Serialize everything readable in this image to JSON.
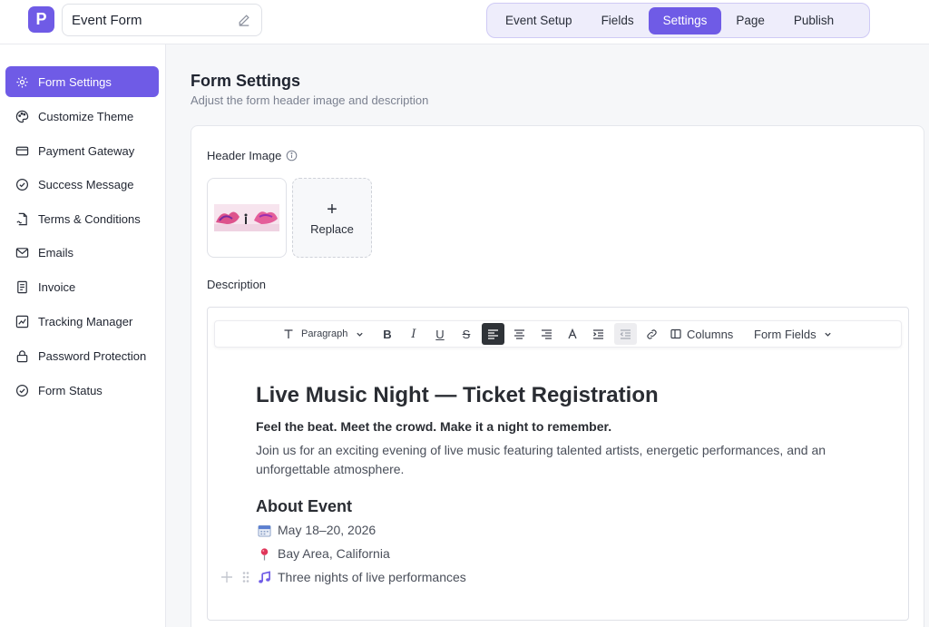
{
  "app": {
    "logo_letter": "P",
    "form_title": "Event Form"
  },
  "tabs": [
    {
      "label": "Event Setup"
    },
    {
      "label": "Fields"
    },
    {
      "label": "Settings",
      "active": true
    },
    {
      "label": "Page"
    },
    {
      "label": "Publish"
    }
  ],
  "sidebar": {
    "items": [
      {
        "label": "Form Settings",
        "icon": "gear-icon",
        "active": true
      },
      {
        "label": "Customize Theme",
        "icon": "palette-icon"
      },
      {
        "label": "Payment Gateway",
        "icon": "credit-card-icon"
      },
      {
        "label": "Success Message",
        "icon": "check-circle-icon"
      },
      {
        "label": "Terms & Conditions",
        "icon": "document-sign-icon"
      },
      {
        "label": "Emails",
        "icon": "mail-icon"
      },
      {
        "label": "Invoice",
        "icon": "invoice-icon"
      },
      {
        "label": "Tracking Manager",
        "icon": "chart-icon"
      },
      {
        "label": "Password Protection",
        "icon": "lock-icon"
      },
      {
        "label": "Form Status",
        "icon": "check-circle-icon"
      }
    ]
  },
  "main": {
    "title": "Form Settings",
    "subtitle": "Adjust the form header image and description",
    "header_image_label": "Header Image",
    "replace_label": "Replace",
    "description_label": "Description"
  },
  "toolbar": {
    "paragraph_label": "Paragraph",
    "columns_label": "Columns",
    "form_fields_label": "Form Fields"
  },
  "document": {
    "heading": "Live Music Night — Ticket Registration",
    "tagline": "Feel the beat. Meet the crowd. Make it a night to remember.",
    "intro": "Join us for an exciting evening of live music featuring talented artists, energetic performances, and an unforgettable atmosphere.",
    "section_heading": "About Event",
    "items": [
      {
        "text": "May 18–20, 2026",
        "icon": "calendar-icon"
      },
      {
        "text": "Bay Area, California",
        "icon": "pin-icon"
      },
      {
        "text": "Three nights of live performances",
        "icon": "music-note-icon"
      }
    ]
  },
  "colors": {
    "accent": "#6f5be6",
    "accent_soft": "#eeedfb"
  }
}
